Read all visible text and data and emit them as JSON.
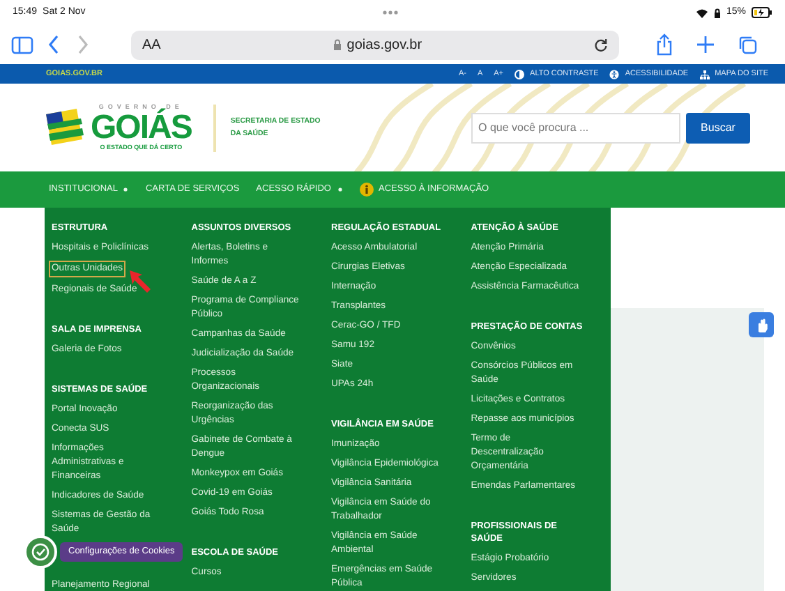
{
  "status_bar": {
    "time": "15:49",
    "date": "Sat 2 Nov",
    "battery": "15%"
  },
  "browser": {
    "text_size": "AA",
    "url": "goias.gov.br"
  },
  "top_bar": {
    "site": "GOIAS.GOV.BR",
    "font_controls": [
      "A-",
      "A",
      "A+"
    ],
    "links": [
      {
        "label": "ALTO CONTRASTE",
        "kind": "contrast"
      },
      {
        "label": "ACESSIBILIDADE",
        "kind": "accessibility"
      },
      {
        "label": "MAPA DO SITE",
        "kind": "sitemap"
      }
    ]
  },
  "header": {
    "logo": {
      "top": "GOVERNO DE",
      "name": "GOIÁS",
      "tagline": "O ESTADO QUE DÁ CERTO"
    },
    "department": [
      "SECRETARIA DE ESTADO",
      "DA SAÚDE"
    ],
    "search": {
      "placeholder": "O que você procura ...",
      "button": "Buscar"
    }
  },
  "nav": [
    {
      "label": "INSTITUCIONAL",
      "dropdown": true,
      "info": false
    },
    {
      "label": "CARTA DE SERVIÇOS",
      "dropdown": false,
      "info": false
    },
    {
      "label": "ACESSO RÁPIDO",
      "dropdown": true,
      "info": false
    },
    {
      "label": "ACESSO À INFORMAÇÃO",
      "dropdown": false,
      "info": true
    }
  ],
  "mega_menu": {
    "columns": [
      {
        "sections": [
          {
            "title": "ESTRUTURA",
            "items": [
              {
                "label": "Hospitais e Policlínicas",
                "highlighted": false
              },
              {
                "label": "Outras Unidades",
                "highlighted": true
              },
              {
                "label": "Regionais de Saúde",
                "highlighted": false
              }
            ]
          },
          {
            "title": "SALA DE IMPRENSA",
            "items": [
              {
                "label": "Galeria de Fotos",
                "highlighted": false
              }
            ]
          },
          {
            "title": "SISTEMAS DE SAÚDE",
            "items": [
              {
                "label": "Portal Inovação",
                "highlighted": false
              },
              {
                "label": "Conecta SUS",
                "highlighted": false
              },
              {
                "label": "Informações Administrativas e Financeiras",
                "highlighted": false
              },
              {
                "label": "Indicadores de Saúde",
                "highlighted": false
              },
              {
                "label": "Sistemas de Gestão da Saúde",
                "highlighted": false
              },
              {
                "label": "Planejamento Regional",
                "highlighted": false
              }
            ]
          }
        ]
      },
      {
        "sections": [
          {
            "title": "ASSUNTOS DIVERSOS",
            "items": [
              {
                "label": "Alertas, Boletins e Informes",
                "highlighted": false
              },
              {
                "label": "Saúde de A a Z",
                "highlighted": false
              },
              {
                "label": "Programa de Compliance Público",
                "highlighted": false
              },
              {
                "label": "Campanhas da Saúde",
                "highlighted": false
              },
              {
                "label": "Judicialização da Saúde",
                "highlighted": false
              },
              {
                "label": "Processos Organizacionais",
                "highlighted": false
              },
              {
                "label": "Reorganização das Urgências",
                "highlighted": false
              },
              {
                "label": "Gabinete de Combate à Dengue",
                "highlighted": false
              },
              {
                "label": "Monkeypox em Goiás",
                "highlighted": false
              },
              {
                "label": "Covid-19 em Goiás",
                "highlighted": false
              },
              {
                "label": "Goiás Todo Rosa",
                "highlighted": false
              }
            ]
          },
          {
            "title": "ESCOLA DE SAÚDE",
            "items": [
              {
                "label": "Cursos",
                "highlighted": false
              }
            ]
          }
        ]
      },
      {
        "sections": [
          {
            "title": "REGULAÇÃO ESTADUAL",
            "items": [
              {
                "label": "Acesso Ambulatorial",
                "highlighted": false
              },
              {
                "label": "Cirurgias Eletivas",
                "highlighted": false
              },
              {
                "label": "Internação",
                "highlighted": false
              },
              {
                "label": "Transplantes",
                "highlighted": false
              },
              {
                "label": "Cerac-GO / TFD",
                "highlighted": false
              },
              {
                "label": "Samu 192",
                "highlighted": false
              },
              {
                "label": "Siate",
                "highlighted": false
              },
              {
                "label": "UPAs 24h",
                "highlighted": false
              }
            ]
          },
          {
            "title": "VIGILÂNCIA EM SAÚDE",
            "items": [
              {
                "label": "Imunização",
                "highlighted": false
              },
              {
                "label": "Vigilância Epidemiológica",
                "highlighted": false
              },
              {
                "label": "Vigilância Sanitária",
                "highlighted": false
              },
              {
                "label": "Vigilância em Saúde do Trabalhador",
                "highlighted": false
              },
              {
                "label": "Vigilância em Saúde Ambiental",
                "highlighted": false
              },
              {
                "label": "Emergências em Saúde Pública",
                "highlighted": false
              }
            ]
          }
        ]
      },
      {
        "sections": [
          {
            "title": "ATENÇÃO À SAÚDE",
            "items": [
              {
                "label": "Atenção Primária",
                "highlighted": false
              },
              {
                "label": "Atenção Especializada",
                "highlighted": false
              },
              {
                "label": "Assistência Farmacêutica",
                "highlighted": false
              }
            ]
          },
          {
            "title": "PRESTAÇÃO DE CONTAS",
            "items": [
              {
                "label": "Convênios",
                "highlighted": false
              },
              {
                "label": "Consórcios Públicos em Saúde",
                "highlighted": false
              },
              {
                "label": "Licitações e Contratos",
                "highlighted": false
              },
              {
                "label": "Repasse aos municípios",
                "highlighted": false
              },
              {
                "label": "Termo de Descentralização Orçamentária",
                "highlighted": false
              },
              {
                "label": "Emendas Parlamentares",
                "highlighted": false
              }
            ]
          },
          {
            "title": "PROFISSIONAIS DE SAÚDE",
            "items": [
              {
                "label": "Estágio Probatório",
                "highlighted": false
              },
              {
                "label": "Servidores",
                "highlighted": false
              }
            ]
          }
        ]
      }
    ]
  },
  "cookie_button": {
    "label": "Configurações de Cookies"
  }
}
